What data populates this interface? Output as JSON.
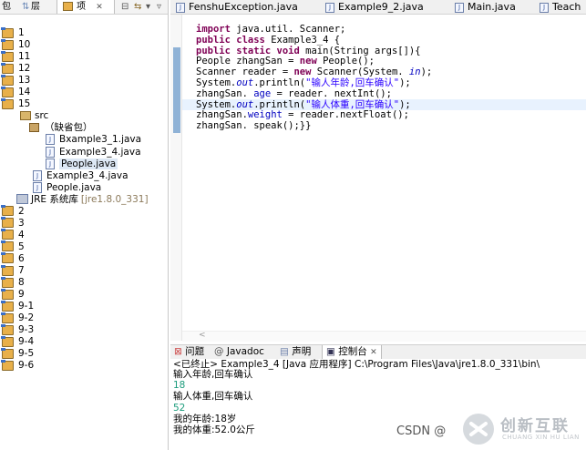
{
  "explorer": {
    "tabs": [
      {
        "label": "包"
      },
      {
        "label": "层"
      },
      {
        "label": "项"
      }
    ],
    "tab_close": "✕",
    "tree": [
      {
        "label": "1",
        "kind": "project"
      },
      {
        "label": "10",
        "kind": "project"
      },
      {
        "label": "11",
        "kind": "project"
      },
      {
        "label": "12",
        "kind": "project"
      },
      {
        "label": "13",
        "kind": "project"
      },
      {
        "label": "14",
        "kind": "project"
      },
      {
        "label": "15",
        "kind": "project"
      },
      {
        "label": "src",
        "kind": "src"
      },
      {
        "label": "（缺省包）",
        "kind": "package"
      },
      {
        "label": "Bxample3_1.java",
        "kind": "file"
      },
      {
        "label": "Example3_4.java",
        "kind": "file"
      },
      {
        "label": "People.java",
        "kind": "file",
        "selected": true
      },
      {
        "label": "Example3_4.java",
        "kind": "file"
      },
      {
        "label": "People.java",
        "kind": "file"
      },
      {
        "label": "JRE 系统库",
        "suffix": "[jre1.8.0_331]",
        "kind": "jre"
      },
      {
        "label": "2",
        "kind": "project"
      },
      {
        "label": "3",
        "kind": "project"
      },
      {
        "label": "4",
        "kind": "project"
      },
      {
        "label": "5",
        "kind": "project"
      },
      {
        "label": "6",
        "kind": "project"
      },
      {
        "label": "7",
        "kind": "project"
      },
      {
        "label": "8",
        "kind": "project"
      },
      {
        "label": "9",
        "kind": "project"
      },
      {
        "label": "9-1",
        "kind": "project"
      },
      {
        "label": "9-2",
        "kind": "project"
      },
      {
        "label": "9-3",
        "kind": "project"
      },
      {
        "label": "9-4",
        "kind": "project"
      },
      {
        "label": "9-5",
        "kind": "project"
      },
      {
        "label": "9-6",
        "kind": "project"
      }
    ]
  },
  "editor": {
    "tabs": [
      {
        "label": "FenshuException.java"
      },
      {
        "label": "Example9_2.java"
      },
      {
        "label": "Main.java"
      },
      {
        "label": "Teach"
      }
    ],
    "code_lines": [
      [
        {
          "t": "import",
          "c": "kw"
        },
        {
          "t": " java.util. Scanner;",
          "c": ""
        }
      ],
      [
        {
          "t": "public",
          "c": "kw"
        },
        {
          "t": " ",
          "c": ""
        },
        {
          "t": "class",
          "c": "kw"
        },
        {
          "t": " Example3_4 {",
          "c": ""
        }
      ],
      [
        {
          "t": "public",
          "c": "kw"
        },
        {
          "t": " ",
          "c": ""
        },
        {
          "t": "static",
          "c": "kw"
        },
        {
          "t": " ",
          "c": ""
        },
        {
          "t": "void",
          "c": "kw"
        },
        {
          "t": " main(String args[]){",
          "c": ""
        }
      ],
      [
        {
          "t": "People zhangSan = ",
          "c": ""
        },
        {
          "t": "new",
          "c": "kw"
        },
        {
          "t": " People();",
          "c": ""
        }
      ],
      [
        {
          "t": "Scanner reader = ",
          "c": ""
        },
        {
          "t": "new",
          "c": "kw"
        },
        {
          "t": " Scanner(System. ",
          "c": ""
        },
        {
          "t": "in",
          "c": "ital"
        },
        {
          "t": ");",
          "c": ""
        }
      ],
      [
        {
          "t": "System.",
          "c": ""
        },
        {
          "t": "out",
          "c": "ital"
        },
        {
          "t": ".println(",
          "c": ""
        },
        {
          "t": "\"输人年龄,回车确认\"",
          "c": "str"
        },
        {
          "t": ");",
          "c": ""
        }
      ],
      [
        {
          "t": "zhangSan. ",
          "c": ""
        },
        {
          "t": "age",
          "c": "fld"
        },
        {
          "t": " = reader. nextInt();",
          "c": ""
        }
      ],
      [
        {
          "t": "System.",
          "c": ""
        },
        {
          "t": "out",
          "c": "ital"
        },
        {
          "t": ".println(",
          "c": ""
        },
        {
          "t": "\"输人体重,回车确认\"",
          "c": "str"
        },
        {
          "t": ");",
          "c": ""
        }
      ],
      [
        {
          "t": "zhangSan.",
          "c": ""
        },
        {
          "t": "weight",
          "c": "fld"
        },
        {
          "t": " = reader.nextFloat();",
          "c": ""
        }
      ],
      [
        {
          "t": "zhangSan. speak();}}",
          "c": ""
        }
      ]
    ],
    "highlighted_line": 7
  },
  "console": {
    "tabs": [
      {
        "label": "问题"
      },
      {
        "label": "Javadoc"
      },
      {
        "label": "声明"
      },
      {
        "label": "控制台",
        "active": true
      }
    ],
    "header": "<已终止> Example3_4 [Java 应用程序] C:\\Program Files\\Java\\jre1.8.0_331\\bin\\",
    "lines": [
      {
        "text": "输入年龄,回车确认",
        "input": false
      },
      {
        "text": "18",
        "input": true
      },
      {
        "text": "输人体重,回车确认",
        "input": false
      },
      {
        "text": "52",
        "input": true
      },
      {
        "text": "我的年龄:18岁",
        "input": false
      },
      {
        "text": "我的体重:52.0公斤",
        "input": false
      }
    ]
  },
  "watermark": {
    "csdn": "CSDN @",
    "brand_cn": "创新互联",
    "brand_en": "CHUANG XIN HU LIAN"
  }
}
